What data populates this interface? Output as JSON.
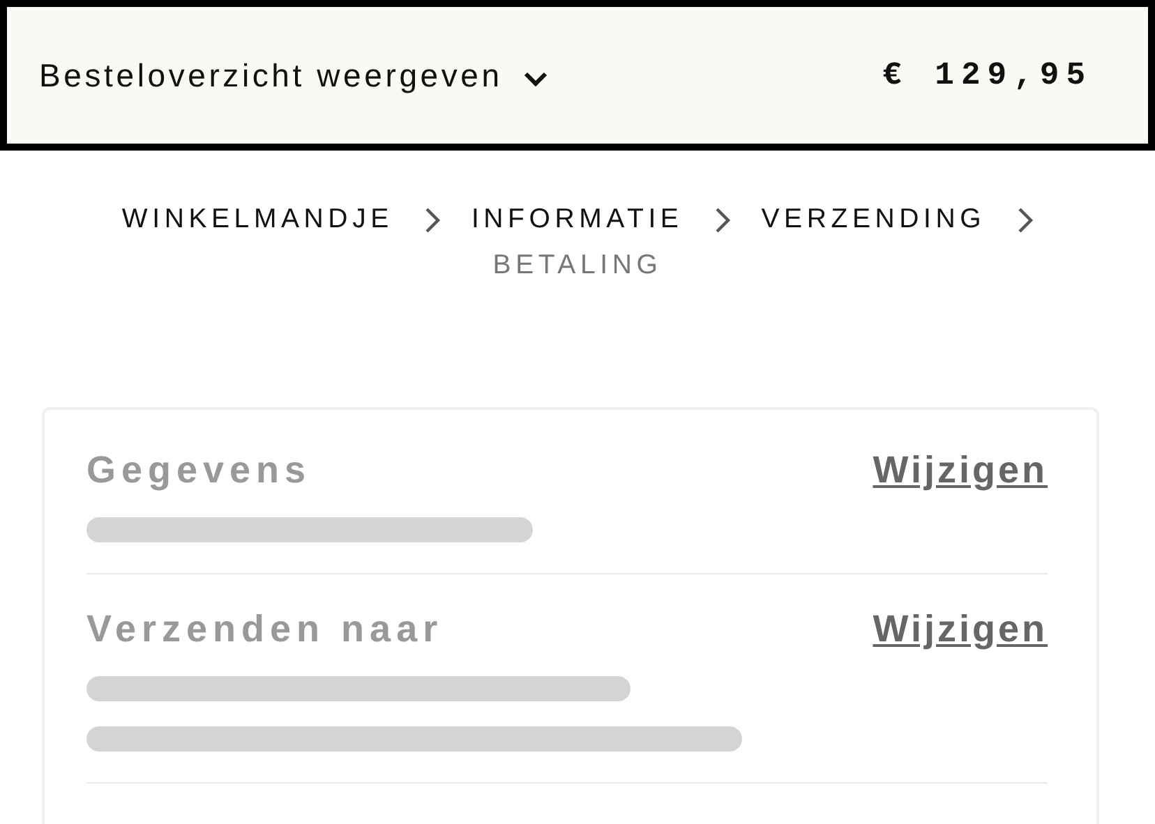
{
  "summary_bar": {
    "toggle_label": "Besteloverzicht weergeven",
    "expanded": false,
    "total": "€ 129,95"
  },
  "breadcrumb": [
    {
      "label": "WINKELMANDJE",
      "selected": false
    },
    {
      "label": "INFORMATIE",
      "selected": false
    },
    {
      "label": "VERZENDING",
      "selected": false
    },
    {
      "label": "BETALING",
      "selected": true
    }
  ],
  "review_card": {
    "sections": [
      {
        "heading": "Gegevens",
        "action": "Wijzigen",
        "lines": [
          {
            "kind": "blurred"
          }
        ]
      },
      {
        "heading": "Verzenden naar",
        "action": "Wijzigen",
        "lines": [
          {
            "kind": "blurred"
          },
          {
            "kind": "blurred"
          }
        ]
      }
    ]
  }
}
